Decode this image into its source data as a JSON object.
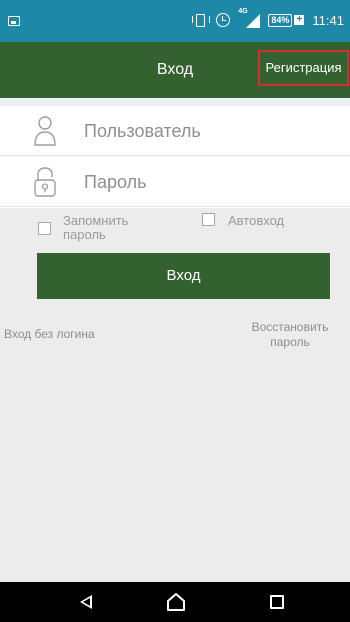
{
  "status_bar": {
    "network_label": "4G",
    "battery": "84%",
    "battery_charge_symbol": "+",
    "time": "11:41",
    "icons": [
      "image-notification-icon",
      "vibrate-icon",
      "alarm-icon",
      "signal-icon",
      "battery-icon"
    ]
  },
  "header": {
    "title": "Вход",
    "register_label": "Регистрация"
  },
  "form": {
    "username_placeholder": "Пользователь",
    "password_placeholder": "Пароль",
    "remember_label_line1": "Запомнить",
    "remember_label_line2": "пароль",
    "auto_login_label": "Автовход",
    "login_button": "Вход"
  },
  "links": {
    "guest_login": "Вход без логина",
    "restore_line1": "Восстановить",
    "restore_line2": "пароль"
  },
  "colors": {
    "status_bar": "#1e88a8",
    "header": "#33612f",
    "highlight_border": "#d32f2f",
    "background": "#ececec"
  }
}
